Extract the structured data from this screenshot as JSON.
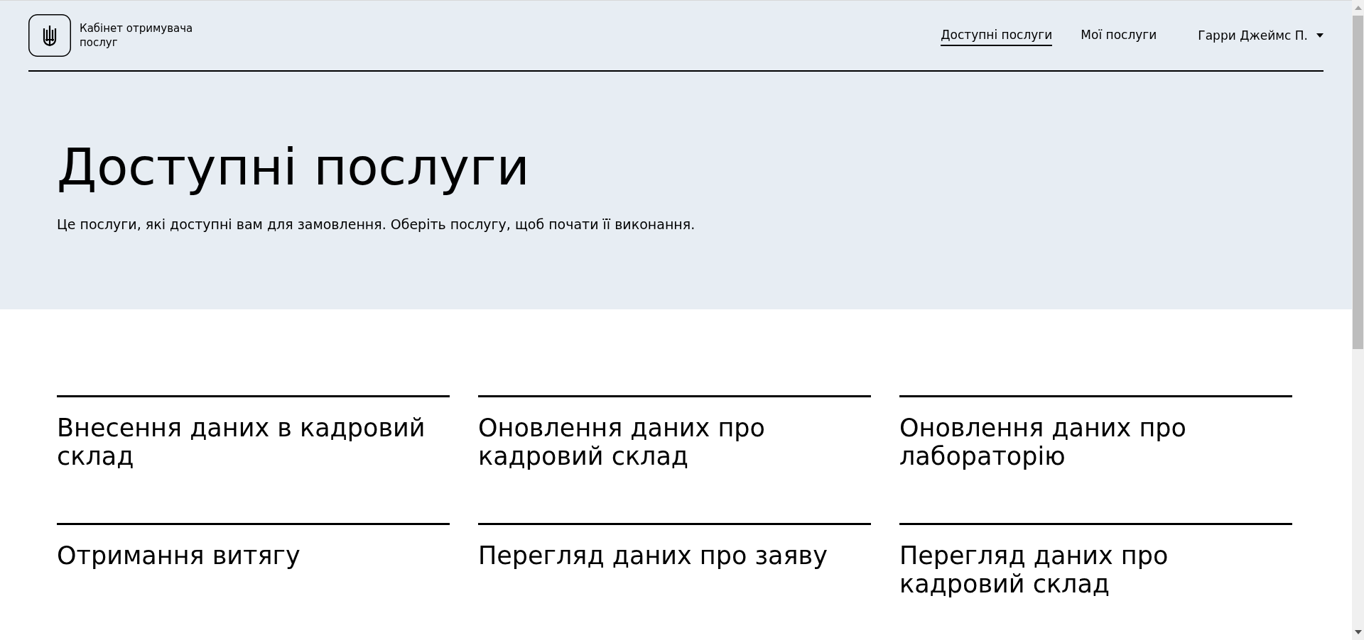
{
  "header": {
    "logo_text": "Кабінет отримувача послуг",
    "nav": [
      {
        "label": "Доступні послуги",
        "selected": true
      },
      {
        "label": "Мої послуги",
        "selected": false
      }
    ],
    "user": "Гарри Джеймс П."
  },
  "hero": {
    "title": "Доступні послуги",
    "subtitle": "Це послуги, які доступні вам для замовлення. Оберіть послугу, щоб почати її виконання."
  },
  "services": [
    "Внесення даних в кадровий склад",
    "Оновлення даних про кадровий склад",
    "Оновлення даних про лабораторію",
    "Отримання витягу",
    "Перегляд даних про заяву",
    "Перегляд даних про кадровий склад"
  ]
}
